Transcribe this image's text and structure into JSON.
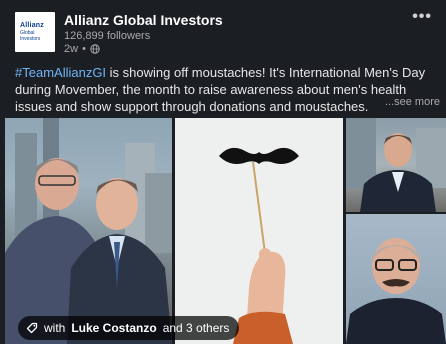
{
  "post": {
    "author": {
      "name": "Allianz Global Investors",
      "followers": "126,899 followers",
      "time": "2w",
      "logo_lines": [
        "Allianz",
        "Global",
        "Investors"
      ]
    },
    "hashtag": "#TeamAllianzGI",
    "body": " is showing off moustaches! It's International Men's Day during Movember, the month to raise awareness about men's health issues and show support through donations and moustaches.",
    "see_more": "...see more"
  },
  "media": {
    "tag_prefix": "with",
    "tag_person": "Luke Costanzo",
    "tag_suffix": "and 3 others"
  },
  "icons": {
    "visibility": "globe-icon",
    "menu": "more-options-icon",
    "tag": "tag-icon"
  },
  "colors": {
    "background": "#1b1f23",
    "hashtag": "#70b5f9",
    "text": "#e6e6e6",
    "muted": "#a8a8a8"
  }
}
